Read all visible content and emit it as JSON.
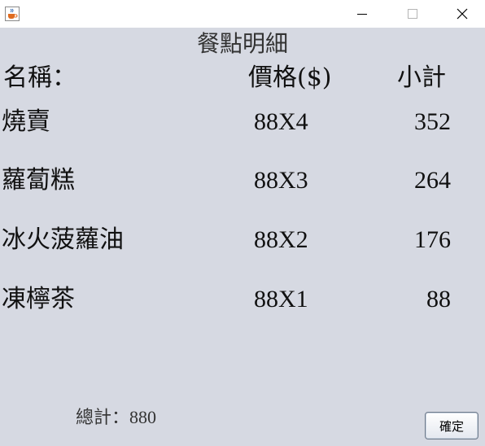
{
  "window": {
    "controls": [
      "minimize-icon",
      "maximize-icon",
      "close-icon"
    ],
    "app_icon": "java-cup-icon"
  },
  "heading": "餐點明細",
  "columns": {
    "name": "名稱：",
    "price": "價格($)",
    "subtotal": "小計"
  },
  "items": [
    {
      "name": "燒賣",
      "price": "88X4",
      "subtotal": "352"
    },
    {
      "name": "蘿蔔糕",
      "price": "88X3",
      "subtotal": "264"
    },
    {
      "name": "冰火菠蘿油",
      "price": "88X2",
      "subtotal": "176"
    },
    {
      "name": "凍檸茶",
      "price": "88X1",
      "subtotal": "88"
    }
  ],
  "total": "總計：880",
  "ok_label": "確定",
  "colors": {
    "background": "#d6d9e2",
    "titlebar": "#ffffff"
  }
}
